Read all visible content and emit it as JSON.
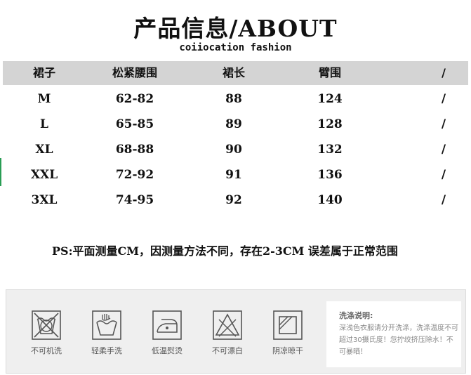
{
  "title": "产品信息/ABOUT",
  "subtitle": "coiiocation fashion",
  "table": {
    "headers": [
      "裙子",
      "松紧腰围",
      "裙长",
      "臂围",
      "/"
    ],
    "rows": [
      [
        "M",
        "62-82",
        "88",
        "124",
        "/"
      ],
      [
        "L",
        "65-85",
        "89",
        "128",
        "/"
      ],
      [
        "XL",
        "68-88",
        "90",
        "132",
        "/"
      ],
      [
        "XXL",
        "72-92",
        "91",
        "136",
        "/"
      ],
      [
        "3XL",
        "74-95",
        "92",
        "140",
        "/"
      ]
    ]
  },
  "note": "PS:平面测量CM，因测量方法不同，存在2-3CM 误差属于正常范围",
  "care": {
    "icons": [
      {
        "icon": "no-machine-wash-icon",
        "label": "不可机洗"
      },
      {
        "icon": "gentle-hand-wash-icon",
        "label": "轻柔手洗"
      },
      {
        "icon": "low-temp-iron-icon",
        "label": "低温熨烫"
      },
      {
        "icon": "no-bleach-icon",
        "label": "不可漂白"
      },
      {
        "icon": "shade-dry-icon",
        "label": "阴凉晾干"
      }
    ],
    "instructions_title": "洗涤说明:",
    "instructions_text": "深浅色衣服请分开洗涤，洗涤温度不可超过30摄氏度！忽拧绞挤压除水！不可暴晒！"
  }
}
